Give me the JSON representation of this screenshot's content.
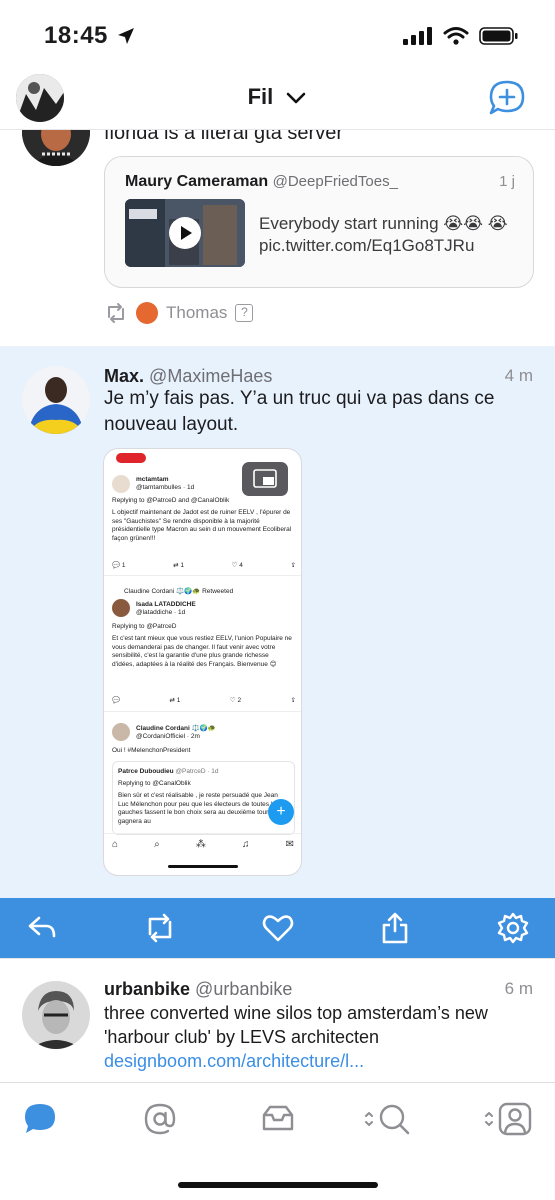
{
  "status": {
    "time": "18:45"
  },
  "header": {
    "title": "Fil"
  },
  "tweet_top": {
    "text": "florida is a literal gta server",
    "quote": {
      "name": "Maury Cameraman",
      "handle": "@DeepFriedToes_",
      "time": "1 j",
      "text": "Everybody start running 😭😭 😭 pic.twitter.com/Eq1Go8TJRu"
    },
    "retweeted_by": "Thomas"
  },
  "tweet_selected": {
    "name": "Max.",
    "handle": "@MaximeHaes",
    "time": "4 m",
    "text": "Je m’y fais pas. Y’a un truc qui va pas dans ce nouveau layout.",
    "embed": {
      "t1_name": "mctamtam",
      "t1_handle": "@tamtambulles · 1d",
      "t1_reply": "Replying to @PatrceD and @CanalOblik",
      "t1_text": "L objectif maintenant de Jadot est de ruiner EELV , l'épurer de ses \"Gauchistes\" Se rendre disponible à la majorité présidentielle type Macron au sein d un mouvement Ecoliberal façon grünen!!!",
      "t1_counts": [
        "1",
        "1",
        "4"
      ],
      "t2_rt": "Claudine Cordani ⚖️🌍🐢 Retweeted",
      "t2_name": "Isada LATADDICHE",
      "t2_handle": "@lataddiche · 1d",
      "t2_reply": "Replying to @PatrceD",
      "t2_text": "Et c'est tant mieux que vous restiez EELV, l'union Populaire ne vous demanderai pas de changer. Il faut venir avec votre sensibilité, c'est la garantie d'une plus grande richesse d'idées, adaptées à la réalité des Français. Bienvenue 😊",
      "t2_counts": [
        "1",
        "2"
      ],
      "t3_name": "Claudine Cordani ⚖️🌍🐢",
      "t3_handle": "@CordaniOfficiel · 2m",
      "t3_text": "Oui ! #MelenchonPresident",
      "t4_name": "Patrce Duboudieu",
      "t4_handle": "@PatrceD · 1d",
      "t4_reply": "Replying to @CanalOblik",
      "t4_text": "Bien sûr et c'est réalisable , je reste persuadé que Jean Luc Mélenchon pour peu que les électeurs de toutes les gauches fassent le bon choix sera au deuxième tour et gagnera au"
    }
  },
  "tweet_bottom": {
    "name": "urbanbike",
    "handle": "@urbanbike",
    "time": "6 m",
    "text": "three converted wine silos top amsterdam’s new 'harbour club' by LEVS architecten",
    "link": "designboom.com/architecture/l..."
  },
  "colors": {
    "accent": "#3d8fe0",
    "selected_bg": "#e8f2fd",
    "link": "#3a8ee6"
  },
  "icons": [
    "location-arrow-icon",
    "signal-icon",
    "wifi-icon",
    "battery-icon",
    "compose-icon",
    "chevron-down-icon",
    "retweet-icon",
    "reply-icon",
    "like-icon",
    "share-icon",
    "settings-icon",
    "timeline-icon",
    "mentions-icon",
    "messages-icon",
    "search-icon",
    "profile-icon"
  ]
}
